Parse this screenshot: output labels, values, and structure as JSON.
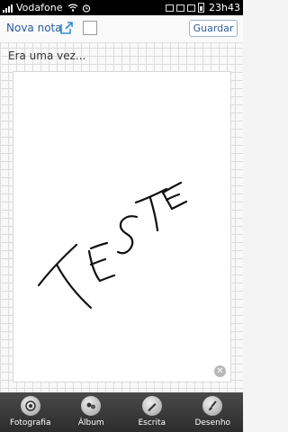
{
  "status_bar": {
    "carrier": "Vodafone",
    "time": "23h43"
  },
  "toolbar": {
    "new_note_label": "Nova nota",
    "save_label": "Guardar"
  },
  "note": {
    "title": "Era uma vez...",
    "drawing_label": "TESTE"
  },
  "bottom_tabs": [
    {
      "label": "Fotografia",
      "icon": "camera-icon"
    },
    {
      "label": "Álbum",
      "icon": "album-icon"
    },
    {
      "label": "Escrita",
      "icon": "pen-icon"
    },
    {
      "label": "Desenho",
      "icon": "brush-icon"
    }
  ]
}
